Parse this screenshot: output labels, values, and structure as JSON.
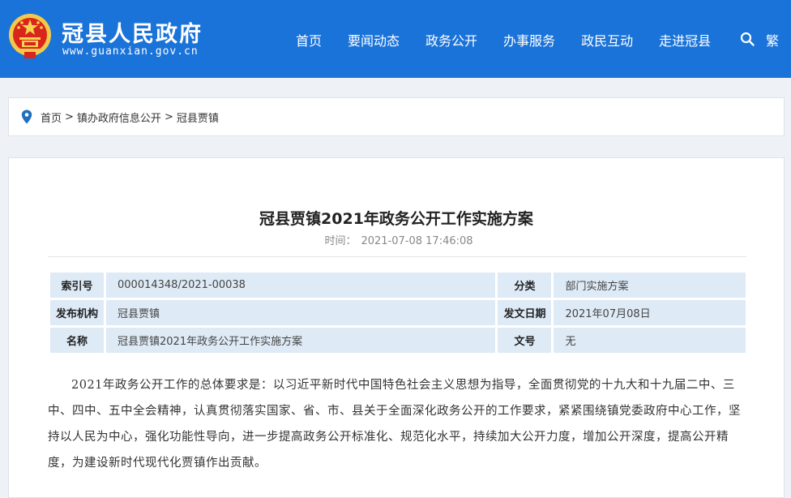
{
  "header": {
    "site_title": "冠县人民政府",
    "site_domain": "www.guanxian.gov.cn",
    "nav": [
      "首页",
      "要闻动态",
      "政务公开",
      "办事服务",
      "政民互动",
      "走进冠县"
    ],
    "search_icon": "search-icon",
    "lang_toggle": "繁",
    "brand_color": "#1a73d9"
  },
  "breadcrumb": {
    "items": [
      "首页",
      "镇办政府信息公开",
      "冠县贾镇"
    ],
    "separator": ">"
  },
  "article": {
    "title": "冠县贾镇2021年政务公开工作实施方案",
    "time_label": "时间：",
    "time_value": "2021-07-08 17:46:08",
    "meta": {
      "index_label": "索引号",
      "index_value": "000014348/2021-00038",
      "category_label": "分类",
      "category_value": "部门实施方案",
      "publisher_label": "发布机构",
      "publisher_value": "冠县贾镇",
      "date_label": "发文日期",
      "date_value": "2021年07月08日",
      "name_label": "名称",
      "name_value": "冠县贾镇2021年政务公开工作实施方案",
      "docno_label": "文号",
      "docno_value": "无"
    },
    "body": "2021年政务公开工作的总体要求是：以习近平新时代中国特色社会主义思想为指导，全面贯彻党的十九大和十九届二中、三中、四中、五中全会精神，认真贯彻落实国家、省、市、县关于全面深化政务公开的工作要求，紧紧围绕镇党委政府中心工作，坚持以人民为中心，强化功能性导向，进一步提高政务公开标准化、规范化水平，持续加大公开力度，增加公开深度，提高公开精度，为建设新时代现代化贾镇作出贡献。"
  }
}
